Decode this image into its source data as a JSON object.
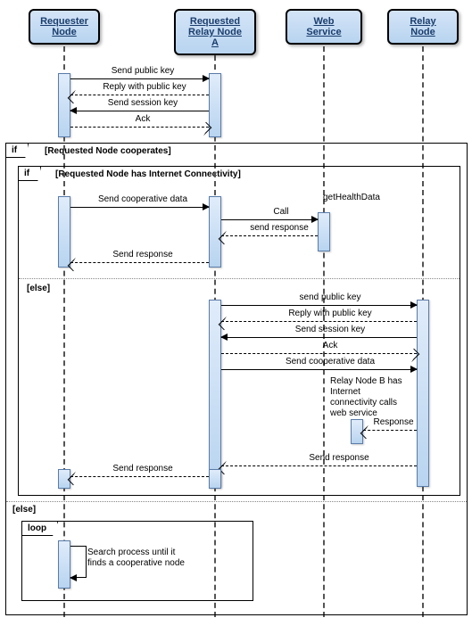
{
  "participants": {
    "requester": "Requester\nNode",
    "relayA": "Requested\nRelay Node A",
    "web": "Web Service",
    "relayB": "Relay Node"
  },
  "messages": {
    "m1": "Send public key",
    "m2": "Reply with public key",
    "m3": "Send session key",
    "m4": "Ack",
    "m5": "Send cooperative data",
    "m6": "getHealthData",
    "m7": "Call",
    "m8": "send response",
    "m9": "Send response",
    "m10": "send public key",
    "m11": "Reply with public key",
    "m12": "Send session key",
    "m13": "Ack",
    "m14": "Send cooperative data",
    "m15": "Response",
    "m16": "Send response",
    "m17": "Send response"
  },
  "frames": {
    "outer_if": "if",
    "outer_guard": "[Requested Node cooperates]",
    "inner_if": "if",
    "inner_guard": "[Requested Node has Internet Connectivity]",
    "inner_else": "[else]",
    "outer_else": "[else]",
    "loop": "loop",
    "loop_text": "Search process until it\nfinds a cooperative node"
  },
  "notes": {
    "relay_note": "Relay Node B has\nInternet\nconnectivity calls\nweb service"
  }
}
